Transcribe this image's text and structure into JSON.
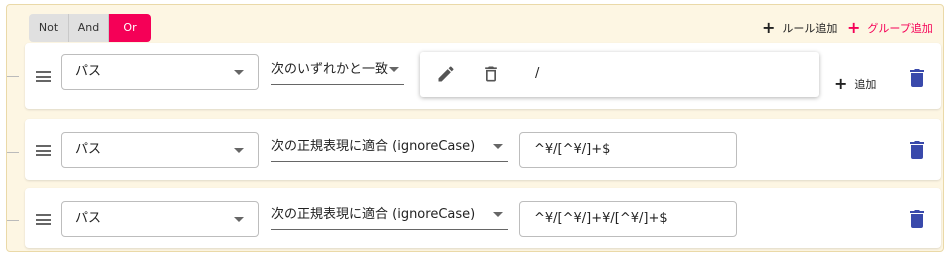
{
  "combinator": {
    "options": [
      "Not",
      "And",
      "Or"
    ],
    "selected": "Or"
  },
  "actions": {
    "add_rule": "ルール追加",
    "add_group": "グループ追加"
  },
  "rules": [
    {
      "field": "パス",
      "operator": "次のいずれかと一致",
      "values": [
        "/"
      ],
      "add_value_label": "追加"
    },
    {
      "field": "パス",
      "operator": "次の正規表現に適合 (ignoreCase)",
      "value": "^¥/[^¥/]+$"
    },
    {
      "field": "パス",
      "operator": "次の正規表現に適合 (ignoreCase)",
      "value": "^¥/[^¥/]+¥/[^¥/]+$"
    }
  ],
  "colors": {
    "accent": "#f50057",
    "delete_icon": "#3949ab",
    "group_background": "#fdf6e3",
    "group_border": "#ead9a8"
  },
  "icons": [
    "drag-handle-icon",
    "chevron-down-icon",
    "pencil-icon",
    "trash-icon",
    "plus-icon"
  ]
}
